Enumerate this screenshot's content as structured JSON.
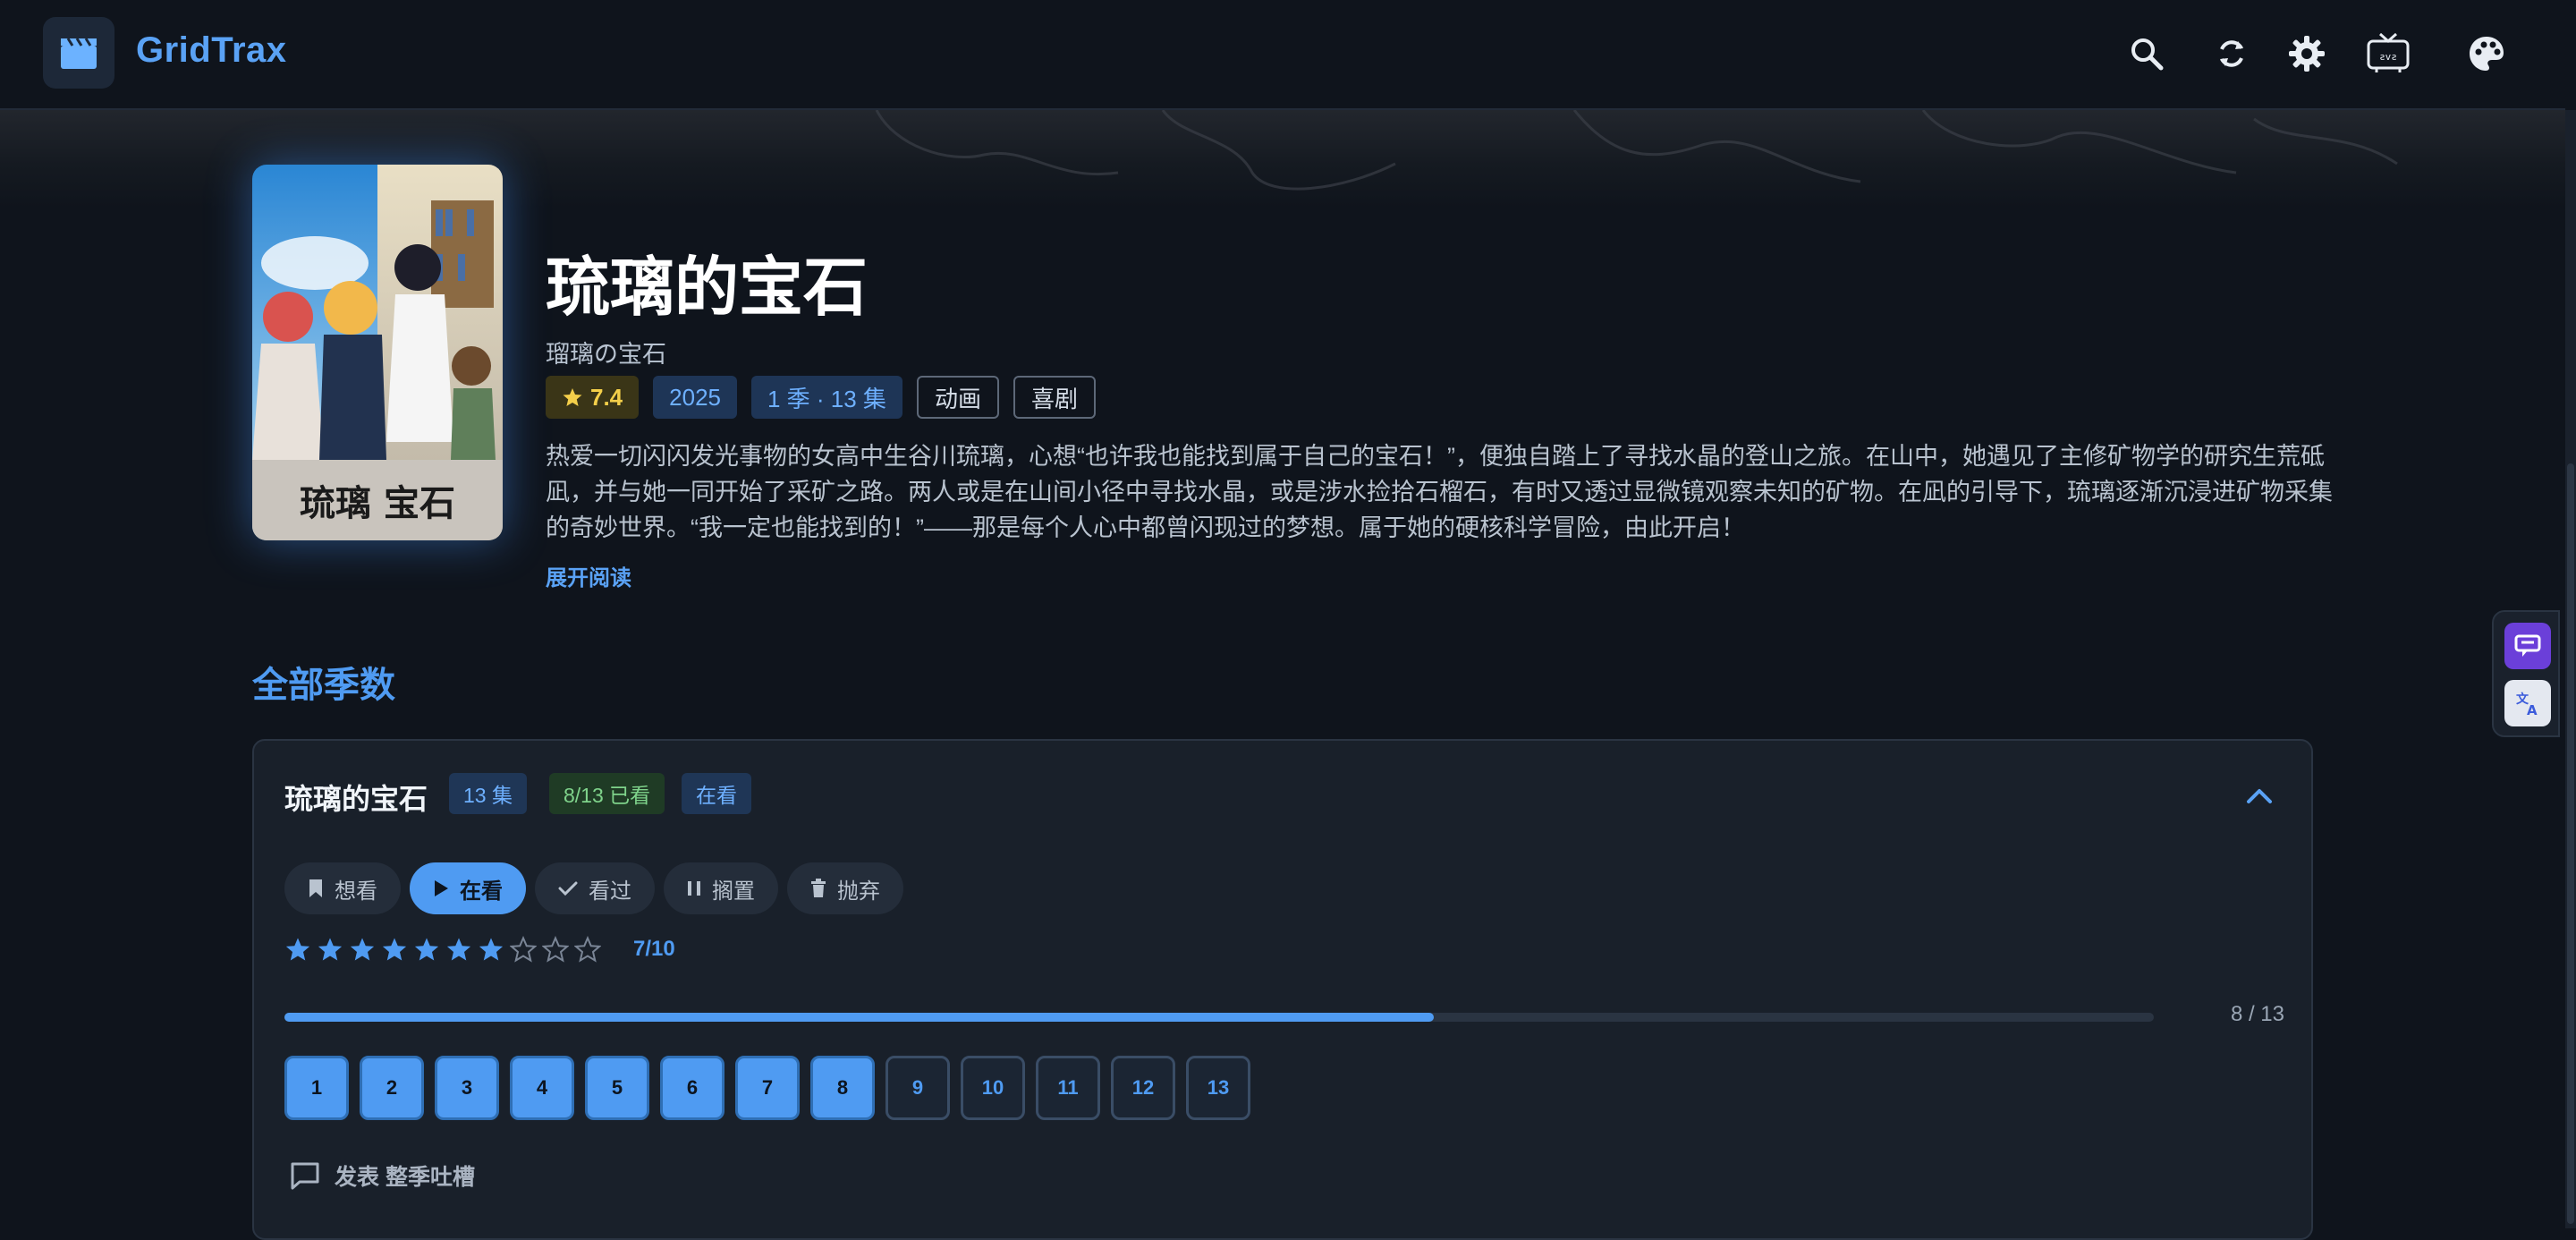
{
  "app": {
    "name": "GridTrax"
  },
  "header": {
    "icons": [
      "search-icon",
      "sync-icon",
      "gear-icon",
      "tv-icon",
      "palette-icon"
    ]
  },
  "show": {
    "title": "琉璃的宝石",
    "original_title": "瑠璃の宝石",
    "rating": "7.4",
    "year": "2025",
    "seasons_episodes": "1 季 · 13 集",
    "genres": [
      "动画",
      "喜剧"
    ],
    "description": "热爱一切闪闪发光事物的女高中生谷川琉璃，心想“也许我也能找到属于自己的宝石！”，便独自踏上了寻找水晶的登山之旅。在山中，她遇见了主修矿物学的研究生荒砥凪，并与她一同开始了采矿之路。两人或是在山间小径中寻找水晶，或是涉水捡拾石榴石，有时又透过显微镜观察未知的矿物。在凪的引导下，琉璃逐渐沉浸进矿物采集的奇妙世界。“我一定也能找到的！”——那是每个人心中都曾闪现过的梦想。属于她的硬核科学冒险，由此开启！",
    "expand_label": "展开阅读"
  },
  "seasons_section": {
    "title": "全部季数",
    "season": {
      "name": "琉璃的宝石",
      "episode_badge": "13 集",
      "watched_badge": "8/13 已看",
      "status_badge": "在看",
      "status_buttons": [
        {
          "label": "想看",
          "icon": "bookmark-icon",
          "active": false
        },
        {
          "label": "在看",
          "icon": "play-icon",
          "active": true
        },
        {
          "label": "看过",
          "icon": "check-icon",
          "active": false
        },
        {
          "label": "搁置",
          "icon": "pause-icon",
          "active": false
        },
        {
          "label": "抛弃",
          "icon": "trash-icon",
          "active": false
        }
      ],
      "user_rating": 7,
      "rating_max": 10,
      "score_label": "7/10",
      "progress_label": "8 / 13",
      "progress_fraction": 0.615,
      "episodes": [
        "1",
        "2",
        "3",
        "4",
        "5",
        "6",
        "7",
        "8",
        "9",
        "10",
        "11",
        "12",
        "13"
      ],
      "watched_count": 8,
      "comment_label": "发表 整季吐槽"
    }
  },
  "colors": {
    "accent": "#4f9bf2",
    "background": "#0f141c",
    "card": "#19202a",
    "rating": "#f4cf4a"
  }
}
